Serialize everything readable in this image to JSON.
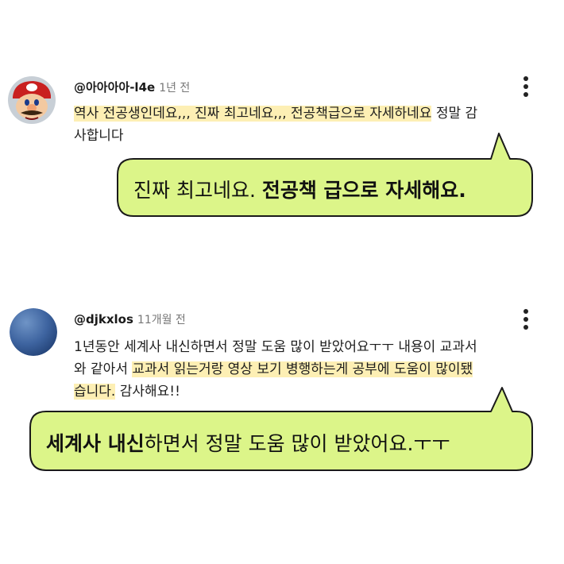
{
  "comments": [
    {
      "username": "@아아아아-l4e",
      "time": "1년 전",
      "line1_hl": "역사 전공생인데요,,, 진짜 최고네요,,, 전공책급으로 자세하네요",
      "line1_rest": " 정말 감",
      "line2": "사합니다",
      "bubble_plain": "진짜 최고네요. ",
      "bubble_bold": "전공책 급으로 자세해요.",
      "avatar_icon": "mario-avatar-icon"
    },
    {
      "username": "@djkxlos",
      "time": "11개월 전",
      "line1": "1년동안 세계사 내신하면서 정말 도움 많이 받았어요ㅜㅜ 내용이 교과서",
      "line2_plain": "와 같아서 ",
      "line2_hl": "교과서 읽는거랑 영상 보기 병행하는게 공부에 도움이 많이됐",
      "line3_hl": "습니다.",
      "line3_rest": " 감사해요!!",
      "bubble_bold": "세계사 내신",
      "bubble_plain": "하면서 정말 도움 많이 받았어요.ㅜㅜ",
      "avatar_icon": "blue-circle-avatar-icon"
    }
  ],
  "colors": {
    "bubble_fill": "#dcf589",
    "bubble_stroke": "#1a1a1a",
    "highlight": "#fdefb4",
    "background": "#ffffff"
  }
}
